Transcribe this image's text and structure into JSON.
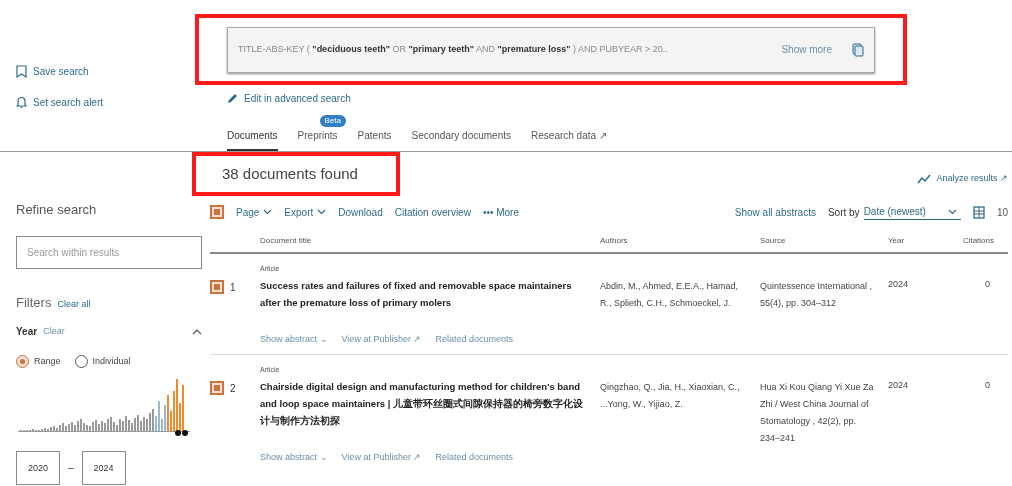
{
  "sidebar": {
    "actions": [
      {
        "kind": "bookmark",
        "label": "Save search"
      },
      {
        "kind": "bell",
        "label": "Set search alert"
      }
    ],
    "refine_title": "Refine search",
    "search": {
      "placeholder": "Search within results"
    },
    "filters": {
      "title": "Filters",
      "clear_all": "Clear all"
    },
    "year": {
      "title": "Year",
      "clear": "Clear",
      "expanded": true,
      "modes": [
        {
          "label": "Range",
          "selected": true
        },
        {
          "label": "Individual",
          "selected": false
        }
      ],
      "from": "2020",
      "separator": "–",
      "to": "2024"
    }
  },
  "query": {
    "text": "TITLE-ABS-KEY ( **\"deciduous teeth\"** OR **\"primary teeth\"** AND **\"premature loss\"** ) AND PUBYEAR > 20..",
    "show_more": "Show more",
    "highlighted": true
  },
  "edit_link": "Edit in advanced search",
  "tabs": [
    {
      "label": "Documents",
      "selected": true
    },
    {
      "label": "Preprints",
      "selected": false,
      "badge": "Beta"
    },
    {
      "label": "Patents",
      "selected": false
    },
    {
      "label": "Secondary documents",
      "selected": false
    },
    {
      "label": "Research data ↗",
      "selected": false
    }
  ],
  "results_count": {
    "text": "38 documents found",
    "highlighted": true
  },
  "analyze": "Analyze results ↗",
  "toolbar": {
    "select_all_checked": true,
    "page": "Page",
    "export": "Export",
    "download": "Download",
    "citation": "Citation overview",
    "more": "••• More",
    "show_all": "Show all abstracts",
    "sort_label": "Sort by",
    "sort_value": "Date (newest)",
    "per_page": "10"
  },
  "table": {
    "columns": [
      "Document title",
      "Authors",
      "Source",
      "Year",
      "Citations"
    ],
    "rows": [
      {
        "type": "Article",
        "number": "1",
        "selected": true,
        "title": "Success rates and failures of fixed and removable space maintainers after the premature loss of primary molers",
        "authors": "Abdin, M., Ahmed, E.E.A., Hamad, R., Splieth, C.H., Schmoeckel, J.",
        "source": "Quintessence International , 55(4), pp. 304–312",
        "year": "2024",
        "citations": "0",
        "links": [
          "Show abstract ⌄",
          "View at Publisher ↗",
          "Related documents"
        ]
      },
      {
        "type": "Article",
        "number": "2",
        "selected": true,
        "title": "Chairside digital design and manufacturing method for children's band and loop space maintainers | 儿童带环丝圈式间隙保持器的椅旁数字化设计与制作方法初探",
        "authors": "Qingzhao, Q., Jia, H., Xiaoxian, C., ...Yong, W., Yijiao, Z.",
        "source": "Hua Xi Kou Qiang Yi Xue Za Zhi / West China Journal of Stomatology , 42(2), pp. 234–241",
        "year": "2024",
        "citations": "0",
        "links": [
          "Show abstract ⌄",
          "View at Publisher ↗",
          "Related documents"
        ]
      }
    ]
  }
}
